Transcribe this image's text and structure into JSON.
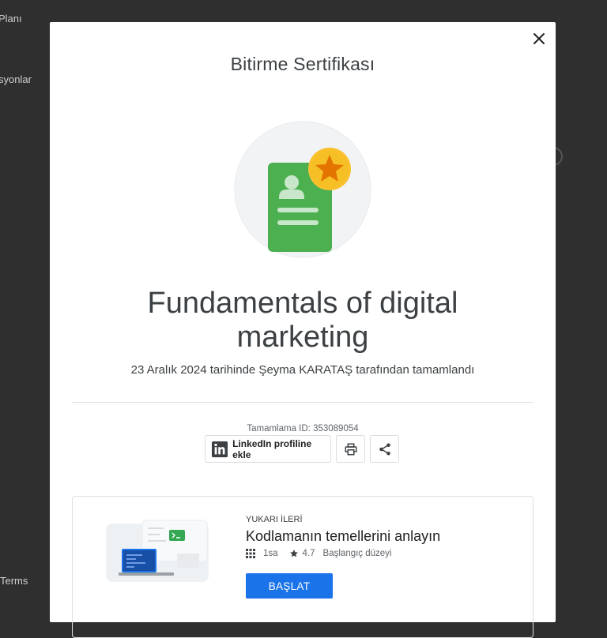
{
  "background": {
    "items": [
      "Planı",
      "syonlar",
      "Terms"
    ]
  },
  "modal": {
    "title": "Bitirme Sertifikası",
    "course_title": "Fundamentals of digital marketing",
    "completed_by": "23 Aralık 2024 tarihinde Şeyma KARATAŞ tarafından tamamlandı",
    "completion_id": "Tamamlama ID: 353089054",
    "linkedin_label": "LinkedIn profiline ekle",
    "icons": {
      "close": "close-icon",
      "badge": "certificate-badge-icon",
      "linkedin": "linkedin-icon",
      "print": "print-icon",
      "share": "share-icon"
    }
  },
  "recommendation": {
    "eyebrow": "YUKARI İLERİ",
    "title": "Kodlamanın temellerini anlayın",
    "duration": "1sa",
    "rating": "4.7",
    "level": "Başlangıç düzeyi",
    "cta": "BAŞLAT"
  },
  "colors": {
    "accent": "#1a73e8",
    "badge_green": "#4caf50",
    "badge_star": "#f6bf26"
  }
}
